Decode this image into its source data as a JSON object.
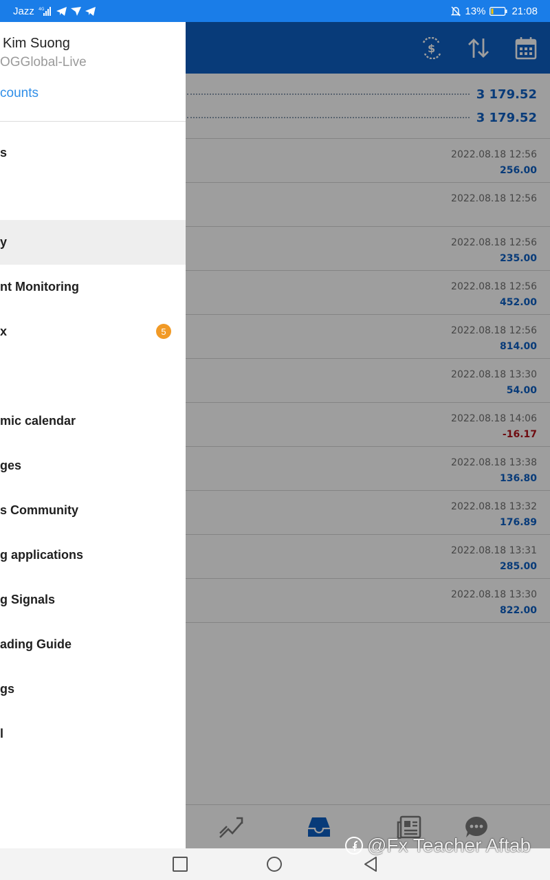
{
  "status_bar": {
    "carrier": "Jazz",
    "network": "4G",
    "battery": "13%",
    "time": "21:08",
    "icons": [
      "signal-icon",
      "telegram-icon",
      "navigation-icon",
      "telegram-icon",
      "mute-icon",
      "battery-icon"
    ]
  },
  "drawer": {
    "account_name": "Kim Suong",
    "account_server": "OGGlobal-Live",
    "accounts_link": "counts",
    "menu": [
      {
        "label": "s",
        "active": false
      },
      {
        "label": "",
        "active": false
      },
      {
        "label": "y",
        "active": true
      },
      {
        "label": "nt Monitoring",
        "active": false
      },
      {
        "label": "x",
        "active": false,
        "badge": "5"
      },
      {
        "label": "",
        "active": false
      },
      {
        "label": "mic calendar",
        "active": false
      },
      {
        "label": "ges",
        "active": false
      },
      {
        "label": "s Community",
        "active": false
      },
      {
        "label": "g applications",
        "active": false
      },
      {
        "label": "g Signals",
        "active": false
      },
      {
        "label": "ading Guide",
        "active": false
      },
      {
        "label": "gs",
        "active": false
      },
      {
        "label": "l",
        "active": false
      }
    ]
  },
  "main": {
    "toolbar_icons": [
      "currency-exchange-icon",
      "sort-icon",
      "calendar-icon"
    ],
    "summary": [
      "3 179.52",
      "3 179.52"
    ],
    "deals": [
      {
        "time": "2022.08.18 12:56",
        "amount": "256.00",
        "negative": false
      },
      {
        "time": "2022.08.18 12:56",
        "amount": "",
        "negative": false
      },
      {
        "time": "2022.08.18 12:56",
        "amount": "235.00",
        "negative": false
      },
      {
        "time": "2022.08.18 12:56",
        "amount": "452.00",
        "negative": false
      },
      {
        "time": "2022.08.18 12:56",
        "amount": "814.00",
        "negative": false
      },
      {
        "time": "2022.08.18 13:30",
        "amount": "54.00",
        "negative": false
      },
      {
        "time": "2022.08.18 14:06",
        "amount": "-16.17",
        "negative": true
      },
      {
        "time": "2022.08.18 13:38",
        "amount": "136.80",
        "negative": false
      },
      {
        "time": "2022.08.18 13:32",
        "amount": "176.89",
        "negative": false
      },
      {
        "time": "2022.08.18 13:31",
        "amount": "285.00",
        "negative": false
      },
      {
        "time": "2022.08.18 13:30",
        "amount": "822.00",
        "negative": false
      }
    ],
    "bottom_nav_icons": [
      "trade-chart-icon",
      "history-inbox-icon",
      "news-icon",
      "chat-icon"
    ]
  },
  "watermark": "@Fx Teacher Aftab",
  "colors": {
    "status_bar": "#1a7de8",
    "toolbar": "#0d5fc4",
    "positive": "#0d5fc4",
    "negative": "#b3131b",
    "badge": "#f19a26",
    "link": "#2f8ee8"
  }
}
